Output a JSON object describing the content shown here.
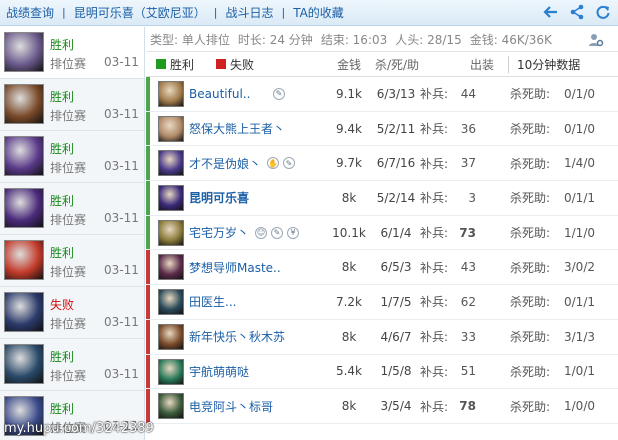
{
  "nav": {
    "crumbs": [
      "战绩查询",
      "昆明可乐喜（艾欧尼亚）",
      "战斗日志",
      "TA的收藏"
    ],
    "icons": [
      "back-arrow-icon",
      "share-icon",
      "refresh-icon"
    ]
  },
  "games": [
    {
      "result": "胜利",
      "win": true,
      "mode": "排位赛",
      "date": "03-11",
      "color": "#6b5a8c"
    },
    {
      "result": "胜利",
      "win": true,
      "mode": "排位赛",
      "date": "03-11",
      "color": "#7a4a2a"
    },
    {
      "result": "胜利",
      "win": true,
      "mode": "排位赛",
      "date": "03-11",
      "color": "#5a3a8a"
    },
    {
      "result": "胜利",
      "win": true,
      "mode": "排位赛",
      "date": "03-11",
      "color": "#4a2a7a"
    },
    {
      "result": "胜利",
      "win": true,
      "mode": "排位赛",
      "date": "03-11",
      "color": "#c23a2a"
    },
    {
      "result": "失败",
      "win": false,
      "mode": "排位赛",
      "date": "03-11",
      "color": "#2a3a6a"
    },
    {
      "result": "胜利",
      "win": true,
      "mode": "排位赛",
      "date": "03-11",
      "color": "#2a4a6a"
    },
    {
      "result": "胜利",
      "win": true,
      "mode": "排位赛",
      "date": "03-11",
      "color": "#3a4a8a"
    }
  ],
  "info": {
    "type": "类型: 单人排位",
    "duration": "时长: 24 分钟",
    "end": "结束: 16:03",
    "players": "人头: 28/15",
    "gold": "金钱: 46K/36K"
  },
  "header": {
    "win_label": "胜利",
    "loss_label": "失败",
    "gold": "金钱",
    "kda": "杀/死/助",
    "cs": "出装",
    "ten_min": "10分钟数据",
    "win_color": "#1f9a1f",
    "loss_color": "#d02020"
  },
  "labels": {
    "cs": "补兵:",
    "k10": "杀死助:"
  },
  "teams": [
    {
      "bar_color": "#4aa84a",
      "players": [
        {
          "name": "Beautiful..",
          "bold": false,
          "badges": [
            "✎"
          ],
          "gold": "9.1k",
          "kda": "6/3/13",
          "cs": "44",
          "cs_bold": false,
          "k10": "0/1/0",
          "color": "#a07a4a"
        },
        {
          "name": "怒保大熊上王者丶",
          "bold": false,
          "badges": [],
          "gold": "9.4k",
          "kda": "5/2/11",
          "cs": "36",
          "cs_bold": false,
          "k10": "0/1/0",
          "color": "#b08a6a"
        },
        {
          "name": "才不是伪娘丶",
          "bold": false,
          "badges": [
            "✋",
            "✎"
          ],
          "gold": "9.7k",
          "kda": "6/7/16",
          "cs": "37",
          "cs_bold": false,
          "k10": "1/4/0",
          "color": "#4a3a8a"
        },
        {
          "name": "昆明可乐喜",
          "bold": true,
          "badges": [],
          "gold": "8k",
          "kda": "5/2/14",
          "cs": "3",
          "cs_bold": false,
          "k10": "0/1/1",
          "color": "#3a2a7a"
        },
        {
          "name": "宅宅万岁丶",
          "bold": false,
          "badges": [
            "☺",
            "✎",
            "¥"
          ],
          "gold": "10.1k",
          "kda": "6/1/4",
          "cs": "73",
          "cs_bold": true,
          "k10": "1/1/0",
          "color": "#8a7a3a"
        }
      ]
    },
    {
      "bar_color": "#c83a3a",
      "players": [
        {
          "name": "梦想导师Maste..",
          "bold": false,
          "badges": [],
          "gold": "8k",
          "kda": "6/5/3",
          "cs": "43",
          "cs_bold": false,
          "k10": "3/0/2",
          "color": "#5a2a4a"
        },
        {
          "name": "田医生...",
          "bold": false,
          "badges": [],
          "gold": "7.2k",
          "kda": "1/7/5",
          "cs": "62",
          "cs_bold": false,
          "k10": "0/1/1",
          "color": "#2a4a5a"
        },
        {
          "name": "新年快乐丶秋木苏",
          "bold": false,
          "badges": [],
          "gold": "8k",
          "kda": "4/6/7",
          "cs": "33",
          "cs_bold": false,
          "k10": "3/1/3",
          "color": "#7a4a2a"
        },
        {
          "name": "宇航萌萌哒",
          "bold": false,
          "badges": [],
          "gold": "5.4k",
          "kda": "1/5/8",
          "cs": "51",
          "cs_bold": false,
          "k10": "1/0/1",
          "color": "#2a7a5a"
        },
        {
          "name": "电竞阿斗丶标哥",
          "bold": false,
          "badges": [],
          "gold": "8k",
          "kda": "3/5/4",
          "cs": "78",
          "cs_bold": true,
          "k10": "1/0/0",
          "color": "#3a5a3a"
        }
      ]
    }
  ],
  "watermark": "my.hupu.com/3242389"
}
